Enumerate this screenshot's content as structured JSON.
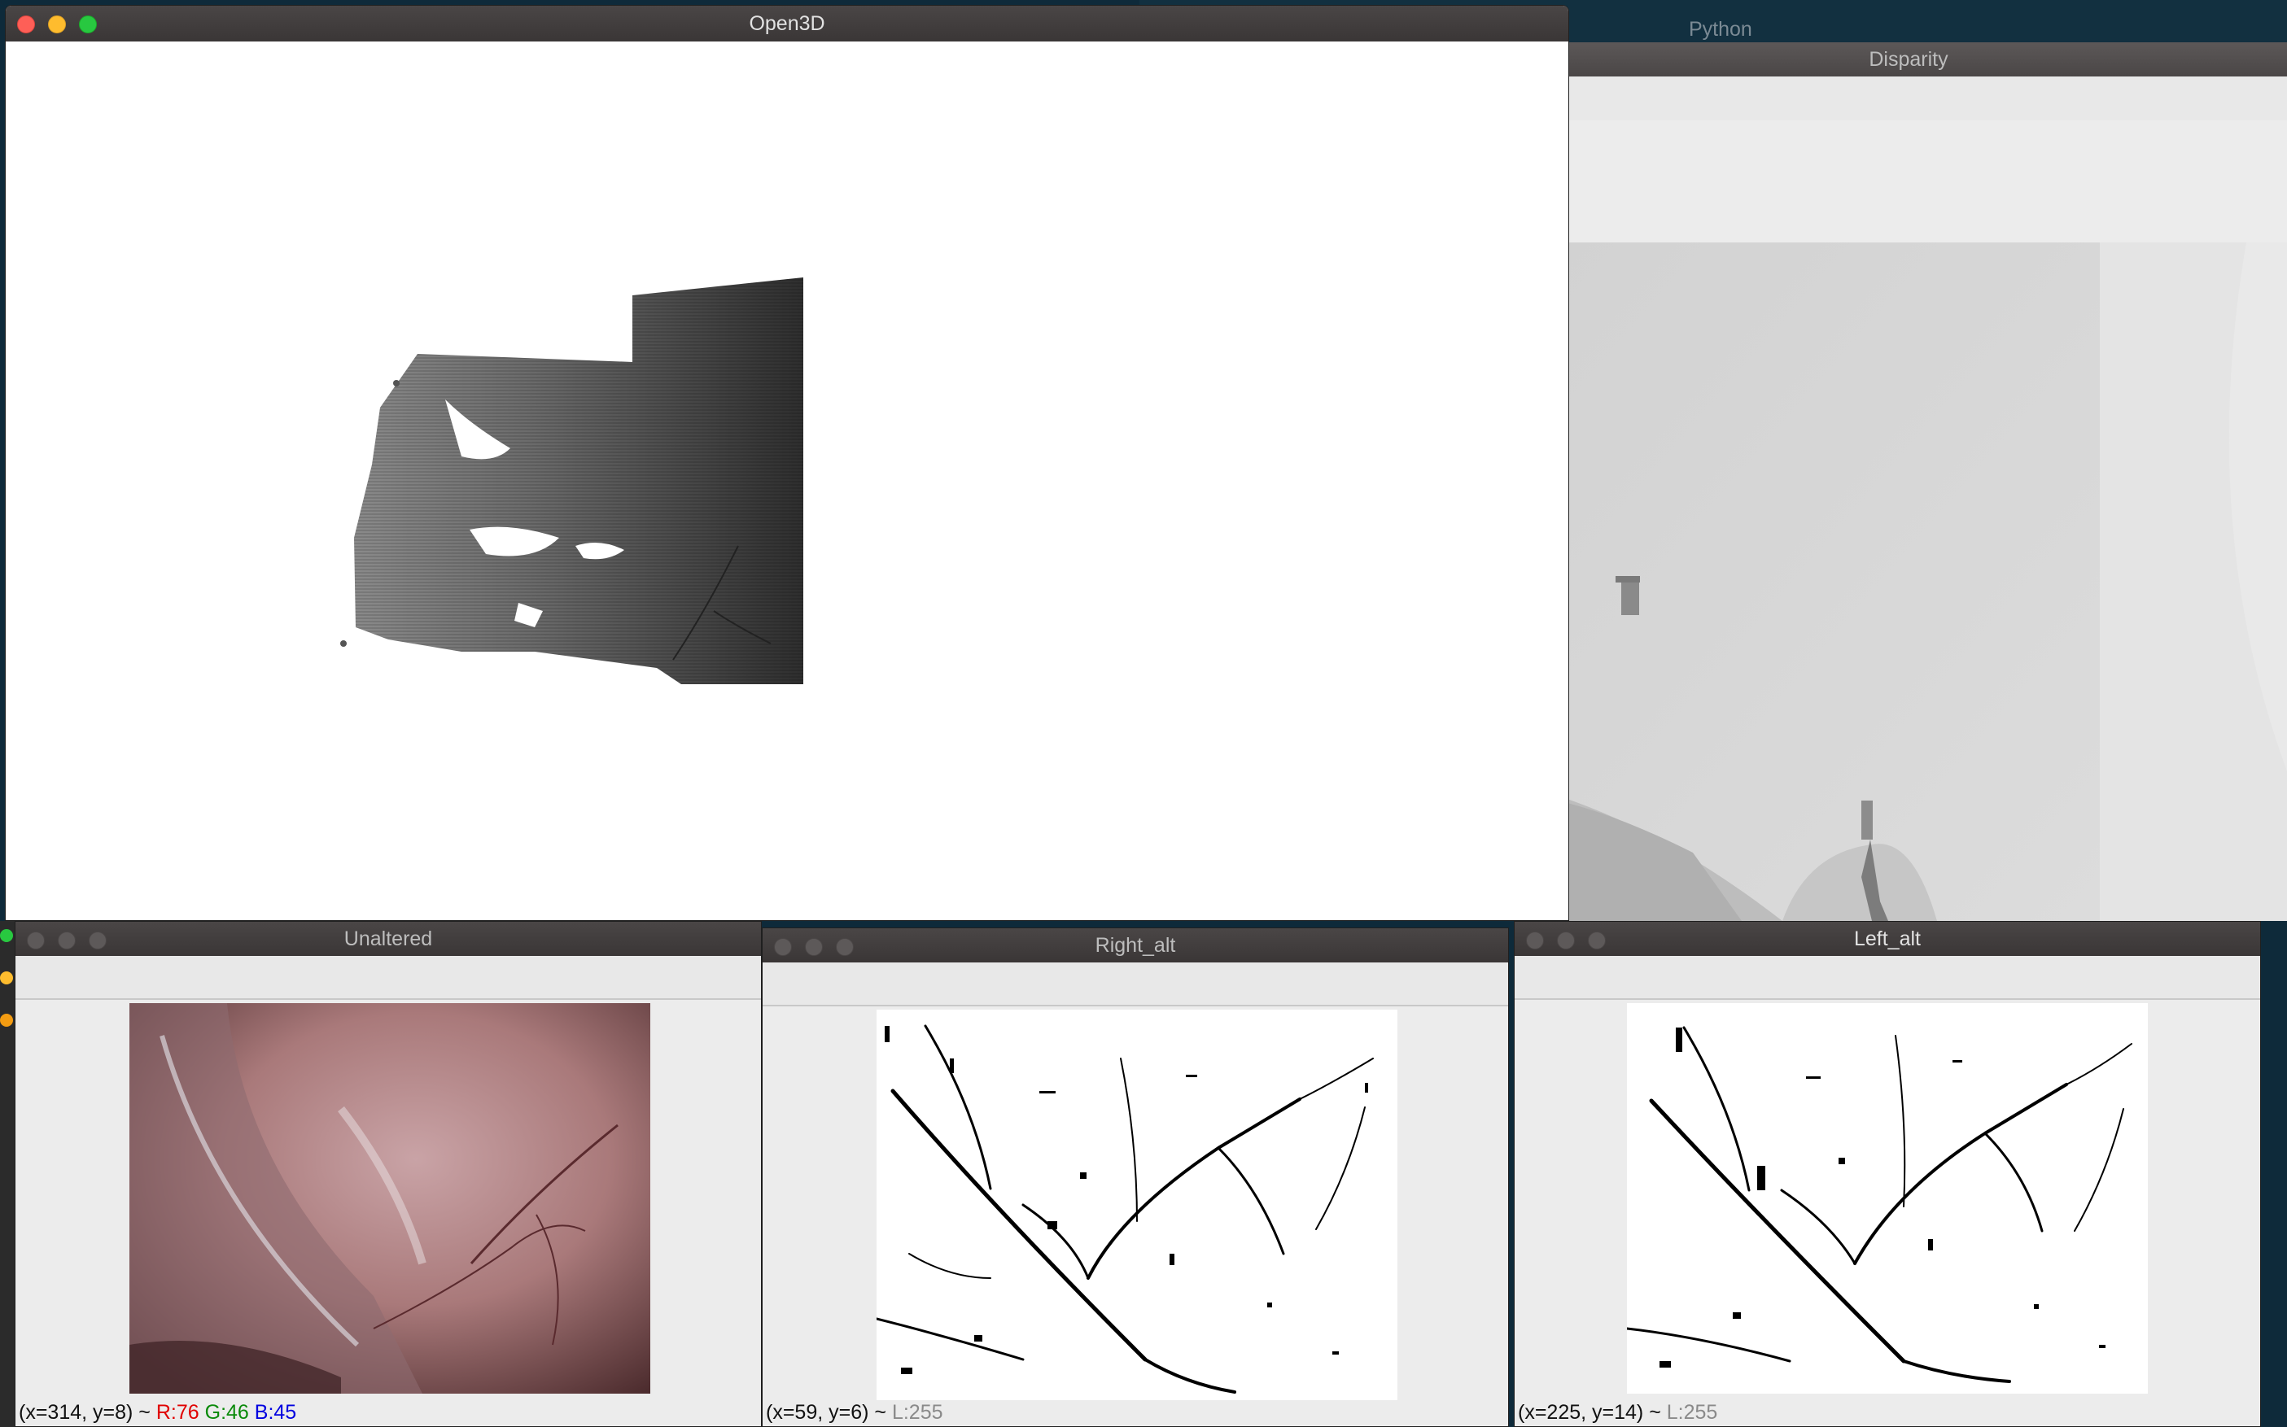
{
  "background_window": {
    "title": "Python"
  },
  "windows": {
    "open3d": {
      "title": "Open3D"
    },
    "disparity": {
      "title": "Disparity"
    },
    "unaltered": {
      "title": "Unaltered",
      "status": {
        "coords": "(x=314, y=8) ~",
        "r": "R:76",
        "g": "G:46",
        "b": "B:45"
      }
    },
    "right_alt": {
      "title": "Right_alt",
      "status": {
        "coords": "(x=59, y=6) ~",
        "l": "L:255"
      }
    },
    "left_alt": {
      "title": "Left_alt",
      "status": {
        "coords": "(x=225, y=14) ~",
        "l": "L:255"
      }
    }
  },
  "icons": [
    "close-button",
    "minimize-button",
    "zoom-button"
  ],
  "colors": {
    "close": "#fe5f57",
    "minimize": "#febc2e",
    "zoom": "#28c840",
    "red_channel": "#e00000",
    "green_channel": "#0a8a0a",
    "blue_channel": "#0000e0"
  }
}
